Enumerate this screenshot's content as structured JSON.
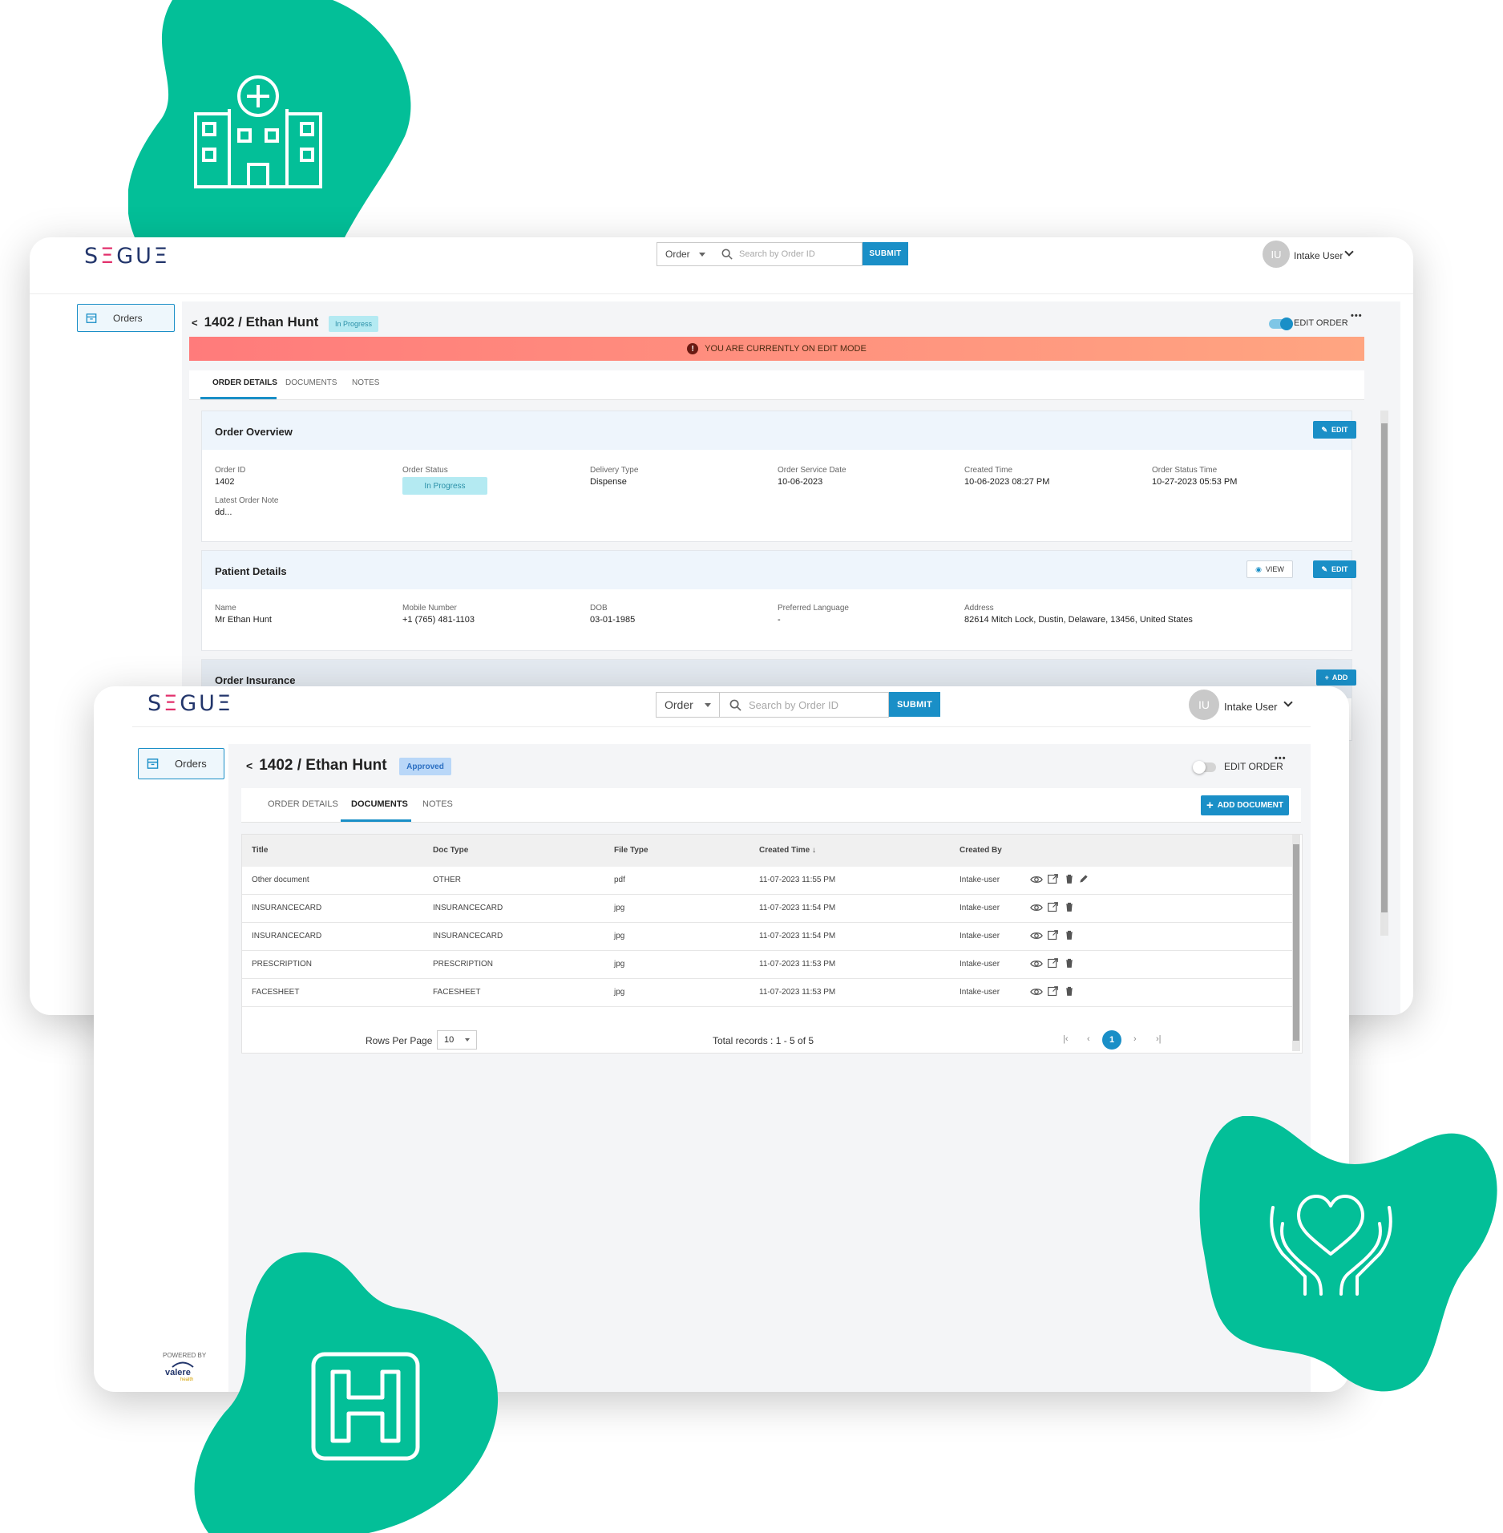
{
  "brand": {
    "logo_text": "SEGUE",
    "accent": "#1a8fc7",
    "blob": "#03bf98",
    "banner_from": "#ff7b7b",
    "banner_to": "#ffa581"
  },
  "back_window": {
    "search": {
      "select_value": "Order",
      "placeholder": "Search by Order ID",
      "submit": "SUBMIT"
    },
    "user": {
      "initials": "IU",
      "name": "Intake User"
    },
    "sidebar": {
      "orders": "Orders"
    },
    "page": {
      "title": "1402 / Ethan Hunt",
      "status": "In Progress",
      "edit_order": "EDIT ORDER",
      "more": "•••"
    },
    "banner": {
      "text": "YOU ARE CURRENTLY ON EDIT MODE"
    },
    "tabs": [
      "ORDER DETAILS",
      "DOCUMENTS",
      "NOTES"
    ],
    "order_overview": {
      "title": "Order Overview",
      "edit": "EDIT",
      "fields": [
        {
          "label": "Order ID",
          "value": "1402"
        },
        {
          "label": "Order Status",
          "value": "In Progress"
        },
        {
          "label": "Delivery Type",
          "value": "Dispense"
        },
        {
          "label": "Order Service Date",
          "value": "10-06-2023"
        },
        {
          "label": "Created Time",
          "value": "10-06-2023 08:27 PM"
        },
        {
          "label": "Order Status Time",
          "value": "10-27-2023 05:53 PM"
        }
      ],
      "note": {
        "label": "Latest Order Note",
        "value": "dd..."
      }
    },
    "patient_details": {
      "title": "Patient Details",
      "view": "VIEW",
      "edit": "EDIT",
      "fields": [
        {
          "label": "Name",
          "value": "Mr Ethan Hunt"
        },
        {
          "label": "Mobile Number",
          "value": "+1 (765) 481-1103"
        },
        {
          "label": "DOB",
          "value": "03-01-1985"
        },
        {
          "label": "Preferred Language",
          "value": "-"
        },
        {
          "label": "Address",
          "value": "82614 Mitch Lock, Dustin, Delaware, 13456, United States"
        }
      ]
    },
    "order_insurance": {
      "title": "Order Insurance",
      "add": "ADD"
    }
  },
  "front_window": {
    "search": {
      "select_value": "Order",
      "placeholder": "Search by Order ID",
      "submit": "SUBMIT"
    },
    "user": {
      "initials": "IU",
      "name": "Intake User"
    },
    "sidebar": {
      "orders": "Orders",
      "powered_by": "POWERED BY",
      "vendor": "valere",
      "vendor_sub": "health"
    },
    "page": {
      "title": "1402 / Ethan Hunt",
      "status": "Approved",
      "edit_order": "EDIT ORDER",
      "more": "•••"
    },
    "tabs": [
      "ORDER DETAILS",
      "DOCUMENTS",
      "NOTES"
    ],
    "add_document": "ADD DOCUMENT",
    "table": {
      "columns": [
        "Title",
        "Doc Type",
        "File Type",
        "Created Time",
        "Created By"
      ],
      "rows": [
        {
          "title": "Other document",
          "doc_type": "OTHER",
          "file_type": "pdf",
          "created_time": "11-07-2023 11:55 PM",
          "created_by": "Intake-user"
        },
        {
          "title": "INSURANCECARD",
          "doc_type": "INSURANCECARD",
          "file_type": "jpg",
          "created_time": "11-07-2023 11:54 PM",
          "created_by": "Intake-user"
        },
        {
          "title": "INSURANCECARD",
          "doc_type": "INSURANCECARD",
          "file_type": "jpg",
          "created_time": "11-07-2023 11:54 PM",
          "created_by": "Intake-user"
        },
        {
          "title": "PRESCRIPTION",
          "doc_type": "PRESCRIPTION",
          "file_type": "jpg",
          "created_time": "11-07-2023 11:53 PM",
          "created_by": "Intake-user"
        },
        {
          "title": "FACESHEET",
          "doc_type": "FACESHEET",
          "file_type": "jpg",
          "created_time": "11-07-2023 11:53 PM",
          "created_by": "Intake-user"
        }
      ]
    },
    "pagination": {
      "rows_per_page_label": "Rows Per Page",
      "rows_per_page": "10",
      "total": "Total records : 1 - 5 of 5",
      "current_page": "1"
    }
  }
}
